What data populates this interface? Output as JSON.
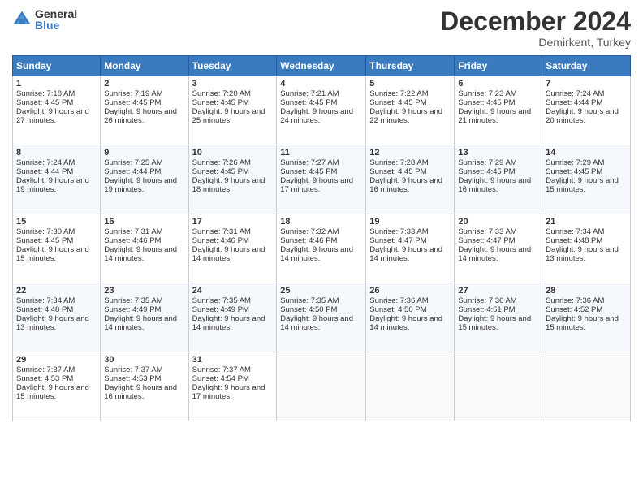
{
  "logo": {
    "general": "General",
    "blue": "Blue"
  },
  "header": {
    "month": "December 2024",
    "location": "Demirkent, Turkey"
  },
  "days_header": [
    "Sunday",
    "Monday",
    "Tuesday",
    "Wednesday",
    "Thursday",
    "Friday",
    "Saturday"
  ],
  "weeks": [
    [
      {
        "day": "1",
        "sunrise": "7:18 AM",
        "sunset": "4:45 PM",
        "daylight": "9 hours and 27 minutes."
      },
      {
        "day": "2",
        "sunrise": "7:19 AM",
        "sunset": "4:45 PM",
        "daylight": "9 hours and 26 minutes."
      },
      {
        "day": "3",
        "sunrise": "7:20 AM",
        "sunset": "4:45 PM",
        "daylight": "9 hours and 25 minutes."
      },
      {
        "day": "4",
        "sunrise": "7:21 AM",
        "sunset": "4:45 PM",
        "daylight": "9 hours and 24 minutes."
      },
      {
        "day": "5",
        "sunrise": "7:22 AM",
        "sunset": "4:45 PM",
        "daylight": "9 hours and 22 minutes."
      },
      {
        "day": "6",
        "sunrise": "7:23 AM",
        "sunset": "4:45 PM",
        "daylight": "9 hours and 21 minutes."
      },
      {
        "day": "7",
        "sunrise": "7:24 AM",
        "sunset": "4:44 PM",
        "daylight": "9 hours and 20 minutes."
      }
    ],
    [
      {
        "day": "8",
        "sunrise": "7:24 AM",
        "sunset": "4:44 PM",
        "daylight": "9 hours and 19 minutes."
      },
      {
        "day": "9",
        "sunrise": "7:25 AM",
        "sunset": "4:44 PM",
        "daylight": "9 hours and 19 minutes."
      },
      {
        "day": "10",
        "sunrise": "7:26 AM",
        "sunset": "4:45 PM",
        "daylight": "9 hours and 18 minutes."
      },
      {
        "day": "11",
        "sunrise": "7:27 AM",
        "sunset": "4:45 PM",
        "daylight": "9 hours and 17 minutes."
      },
      {
        "day": "12",
        "sunrise": "7:28 AM",
        "sunset": "4:45 PM",
        "daylight": "9 hours and 16 minutes."
      },
      {
        "day": "13",
        "sunrise": "7:29 AM",
        "sunset": "4:45 PM",
        "daylight": "9 hours and 16 minutes."
      },
      {
        "day": "14",
        "sunrise": "7:29 AM",
        "sunset": "4:45 PM",
        "daylight": "9 hours and 15 minutes."
      }
    ],
    [
      {
        "day": "15",
        "sunrise": "7:30 AM",
        "sunset": "4:45 PM",
        "daylight": "9 hours and 15 minutes."
      },
      {
        "day": "16",
        "sunrise": "7:31 AM",
        "sunset": "4:46 PM",
        "daylight": "9 hours and 14 minutes."
      },
      {
        "day": "17",
        "sunrise": "7:31 AM",
        "sunset": "4:46 PM",
        "daylight": "9 hours and 14 minutes."
      },
      {
        "day": "18",
        "sunrise": "7:32 AM",
        "sunset": "4:46 PM",
        "daylight": "9 hours and 14 minutes."
      },
      {
        "day": "19",
        "sunrise": "7:33 AM",
        "sunset": "4:47 PM",
        "daylight": "9 hours and 14 minutes."
      },
      {
        "day": "20",
        "sunrise": "7:33 AM",
        "sunset": "4:47 PM",
        "daylight": "9 hours and 14 minutes."
      },
      {
        "day": "21",
        "sunrise": "7:34 AM",
        "sunset": "4:48 PM",
        "daylight": "9 hours and 13 minutes."
      }
    ],
    [
      {
        "day": "22",
        "sunrise": "7:34 AM",
        "sunset": "4:48 PM",
        "daylight": "9 hours and 13 minutes."
      },
      {
        "day": "23",
        "sunrise": "7:35 AM",
        "sunset": "4:49 PM",
        "daylight": "9 hours and 14 minutes."
      },
      {
        "day": "24",
        "sunrise": "7:35 AM",
        "sunset": "4:49 PM",
        "daylight": "9 hours and 14 minutes."
      },
      {
        "day": "25",
        "sunrise": "7:35 AM",
        "sunset": "4:50 PM",
        "daylight": "9 hours and 14 minutes."
      },
      {
        "day": "26",
        "sunrise": "7:36 AM",
        "sunset": "4:50 PM",
        "daylight": "9 hours and 14 minutes."
      },
      {
        "day": "27",
        "sunrise": "7:36 AM",
        "sunset": "4:51 PM",
        "daylight": "9 hours and 15 minutes."
      },
      {
        "day": "28",
        "sunrise": "7:36 AM",
        "sunset": "4:52 PM",
        "daylight": "9 hours and 15 minutes."
      }
    ],
    [
      {
        "day": "29",
        "sunrise": "7:37 AM",
        "sunset": "4:53 PM",
        "daylight": "9 hours and 15 minutes."
      },
      {
        "day": "30",
        "sunrise": "7:37 AM",
        "sunset": "4:53 PM",
        "daylight": "9 hours and 16 minutes."
      },
      {
        "day": "31",
        "sunrise": "7:37 AM",
        "sunset": "4:54 PM",
        "daylight": "9 hours and 17 minutes."
      },
      null,
      null,
      null,
      null
    ]
  ],
  "labels": {
    "sunrise": "Sunrise:",
    "sunset": "Sunset:",
    "daylight": "Daylight:"
  }
}
